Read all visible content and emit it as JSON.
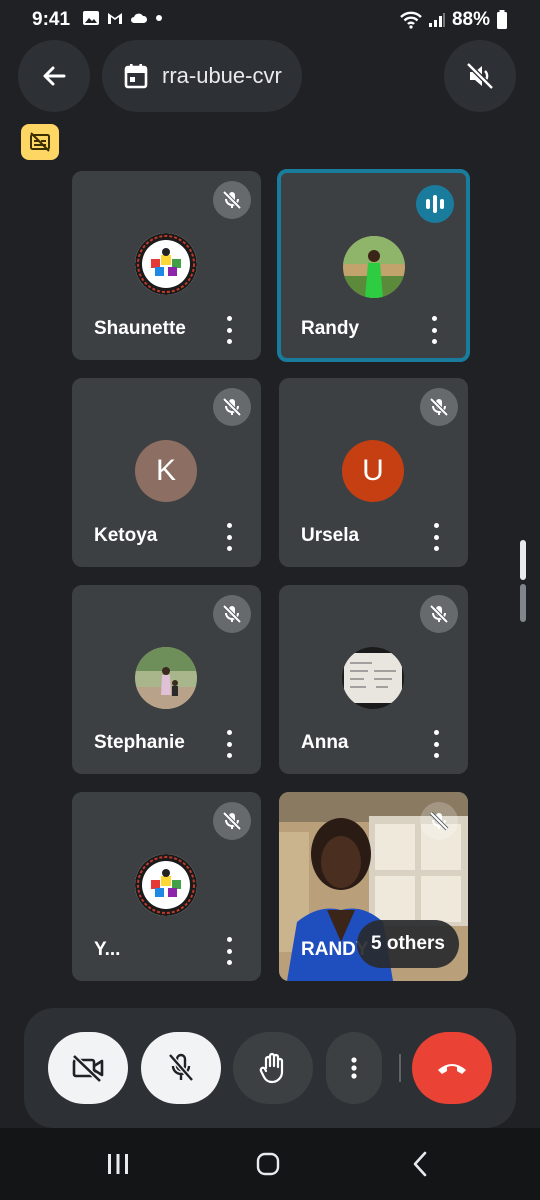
{
  "status_bar": {
    "time": "9:41",
    "battery": "88%"
  },
  "meeting": {
    "code": "rra-ubue-cvr"
  },
  "participants": [
    {
      "name": "Shaunette",
      "avatar_type": "logo",
      "muted": true
    },
    {
      "name": "Randy",
      "avatar_type": "photo",
      "speaking": true
    },
    {
      "name": "Ketoya",
      "avatar_type": "initial",
      "initial": "K",
      "avatar_color": "#8d6e63",
      "muted": true
    },
    {
      "name": "Ursela",
      "avatar_type": "initial",
      "initial": "U",
      "avatar_color": "#c53f13",
      "muted": true
    },
    {
      "name": "Stephanie",
      "avatar_type": "photo",
      "muted": true
    },
    {
      "name": "Anna",
      "avatar_type": "photo",
      "muted": true
    },
    {
      "name": "Y...",
      "avatar_type": "logo",
      "muted": true
    },
    {
      "name": "RANDY",
      "avatar_type": "video",
      "muted": true
    }
  ],
  "others_chip": "5 others",
  "colors": {
    "active_border": "#1a7c9c",
    "end_call": "#ea4335",
    "caption_badge": "#fdd663"
  }
}
